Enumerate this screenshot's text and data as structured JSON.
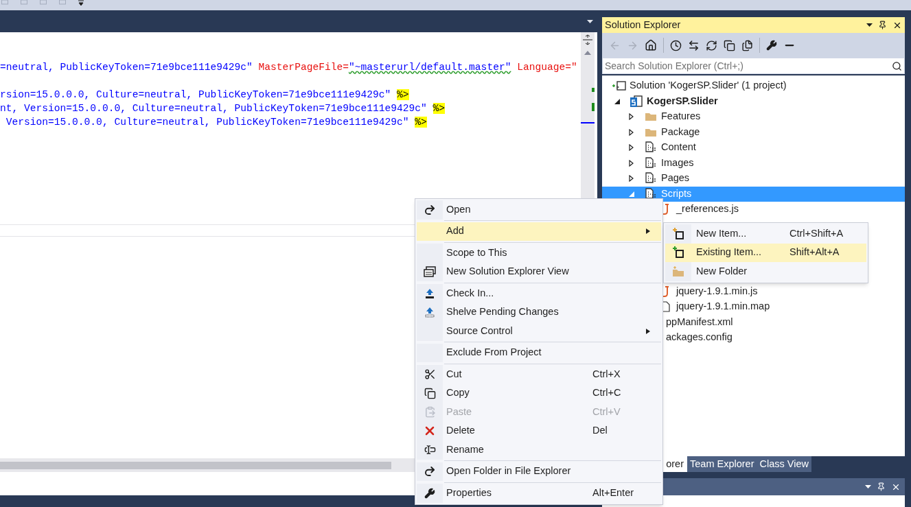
{
  "editor": {
    "lines": [
      {
        "segments": [
          {
            "kind": "value",
            "text": "=neutral, PublicKeyToken=71e9bce111e9429c\""
          },
          {
            "kind": "attr",
            "text": " MasterPageFile="
          },
          {
            "kind": "value",
            "text": "\"~masterurl/default.master\"",
            "squiggle": true
          },
          {
            "kind": "attr",
            "text": " Language=\""
          }
        ]
      },
      {
        "segments": [
          {
            "kind": "value",
            "text": "rsion=15.0.0.0, Culture=neutral, PublicKeyToken=71e9bce111e9429c\" "
          },
          {
            "kind": "delimiter",
            "text": "%>"
          }
        ]
      },
      {
        "segments": [
          {
            "kind": "value",
            "text": "nt, Version=15.0.0.0, Culture=neutral, PublicKeyToken=71e9bce111e9429c\" "
          },
          {
            "kind": "delimiter",
            "text": "%>"
          }
        ]
      },
      {
        "segments": [
          {
            "kind": "value",
            "text": " Version=15.0.0.0, Culture=neutral, PublicKeyToken=71e9bce111e9429c\" "
          },
          {
            "kind": "delimiter",
            "text": "%>"
          }
        ]
      }
    ]
  },
  "solution_explorer": {
    "title": "Solution Explorer",
    "search": {
      "placeholder": "Search Solution Explorer (Ctrl+;)"
    },
    "tree": [
      {
        "label": "Solution 'KogerSP.Slider' (1 project)",
        "kind": "solution",
        "selected": false,
        "children": [
          {
            "label": "KogerSP.Slider",
            "kind": "project",
            "expanded": true,
            "selected": false,
            "children": [
              {
                "label": "Features",
                "kind": "folder",
                "expanded": false,
                "selected": false
              },
              {
                "label": "Package",
                "kind": "folder",
                "expanded": false,
                "selected": false
              },
              {
                "label": "Content",
                "kind": "module",
                "expanded": false,
                "selected": false
              },
              {
                "label": "Images",
                "kind": "module",
                "expanded": false,
                "selected": false
              },
              {
                "label": "Pages",
                "kind": "module",
                "expanded": false,
                "selected": false
              },
              {
                "label": "Scripts",
                "kind": "module",
                "expanded": true,
                "selected": true,
                "children": [
                  {
                    "label": "_references.js",
                    "kind": "script",
                    "selected": false
                  },
                  {
                    "label": "jquery-1.9.1.min.js",
                    "kind": "script",
                    "selected": false
                  },
                  {
                    "label": "jquery-1.9.1.min.map",
                    "kind": "file",
                    "selected": false
                  }
                ]
              },
              {
                "label": "ppManifest.xml",
                "kind": "covered",
                "selected": false
              },
              {
                "label": "ackages.config",
                "kind": "covered",
                "selected": false
              }
            ]
          }
        ]
      }
    ],
    "tabs": [
      {
        "label": "orer",
        "selected": true
      },
      {
        "label": "Team Explorer",
        "selected": false
      },
      {
        "label": "Class View",
        "selected": false
      }
    ]
  },
  "context_menu": [
    {
      "kind": "item",
      "label": "Open",
      "selected": false,
      "disabled": false
    },
    {
      "kind": "separator"
    },
    {
      "kind": "item",
      "label": "Add",
      "submenu": true,
      "selected": true,
      "disabled": false
    },
    {
      "kind": "separator"
    },
    {
      "kind": "item",
      "label": "Scope to This",
      "selected": false,
      "disabled": false
    },
    {
      "kind": "item",
      "label": "New Solution Explorer View",
      "selected": false,
      "disabled": false
    },
    {
      "kind": "separator"
    },
    {
      "kind": "item",
      "label": "Check In...",
      "selected": false,
      "disabled": false
    },
    {
      "kind": "item",
      "label": "Shelve Pending Changes",
      "selected": false,
      "disabled": false
    },
    {
      "kind": "item",
      "label": "Source Control",
      "submenu": true,
      "selected": false,
      "disabled": false
    },
    {
      "kind": "separator"
    },
    {
      "kind": "item",
      "label": "Exclude From Project",
      "selected": false,
      "disabled": false
    },
    {
      "kind": "separator"
    },
    {
      "kind": "item",
      "label": "Cut",
      "shortcut": "Ctrl+X",
      "selected": false,
      "disabled": false
    },
    {
      "kind": "item",
      "label": "Copy",
      "shortcut": "Ctrl+C",
      "selected": false,
      "disabled": false
    },
    {
      "kind": "item",
      "label": "Paste",
      "shortcut": "Ctrl+V",
      "selected": false,
      "disabled": true
    },
    {
      "kind": "item",
      "label": "Delete",
      "shortcut": "Del",
      "selected": false,
      "disabled": false
    },
    {
      "kind": "item",
      "label": "Rename",
      "selected": false,
      "disabled": false
    },
    {
      "kind": "separator"
    },
    {
      "kind": "item",
      "label": "Open Folder in File Explorer",
      "selected": false,
      "disabled": false
    },
    {
      "kind": "separator"
    },
    {
      "kind": "item",
      "label": "Properties",
      "shortcut": "Alt+Enter",
      "selected": false,
      "disabled": false
    }
  ],
  "add_submenu": [
    {
      "label": "New Item...",
      "shortcut": "Ctrl+Shift+A",
      "selected": false
    },
    {
      "label": "Existing Item...",
      "shortcut": "Shift+Alt+A",
      "selected": true
    },
    {
      "label": "New Folder",
      "selected": false
    }
  ]
}
